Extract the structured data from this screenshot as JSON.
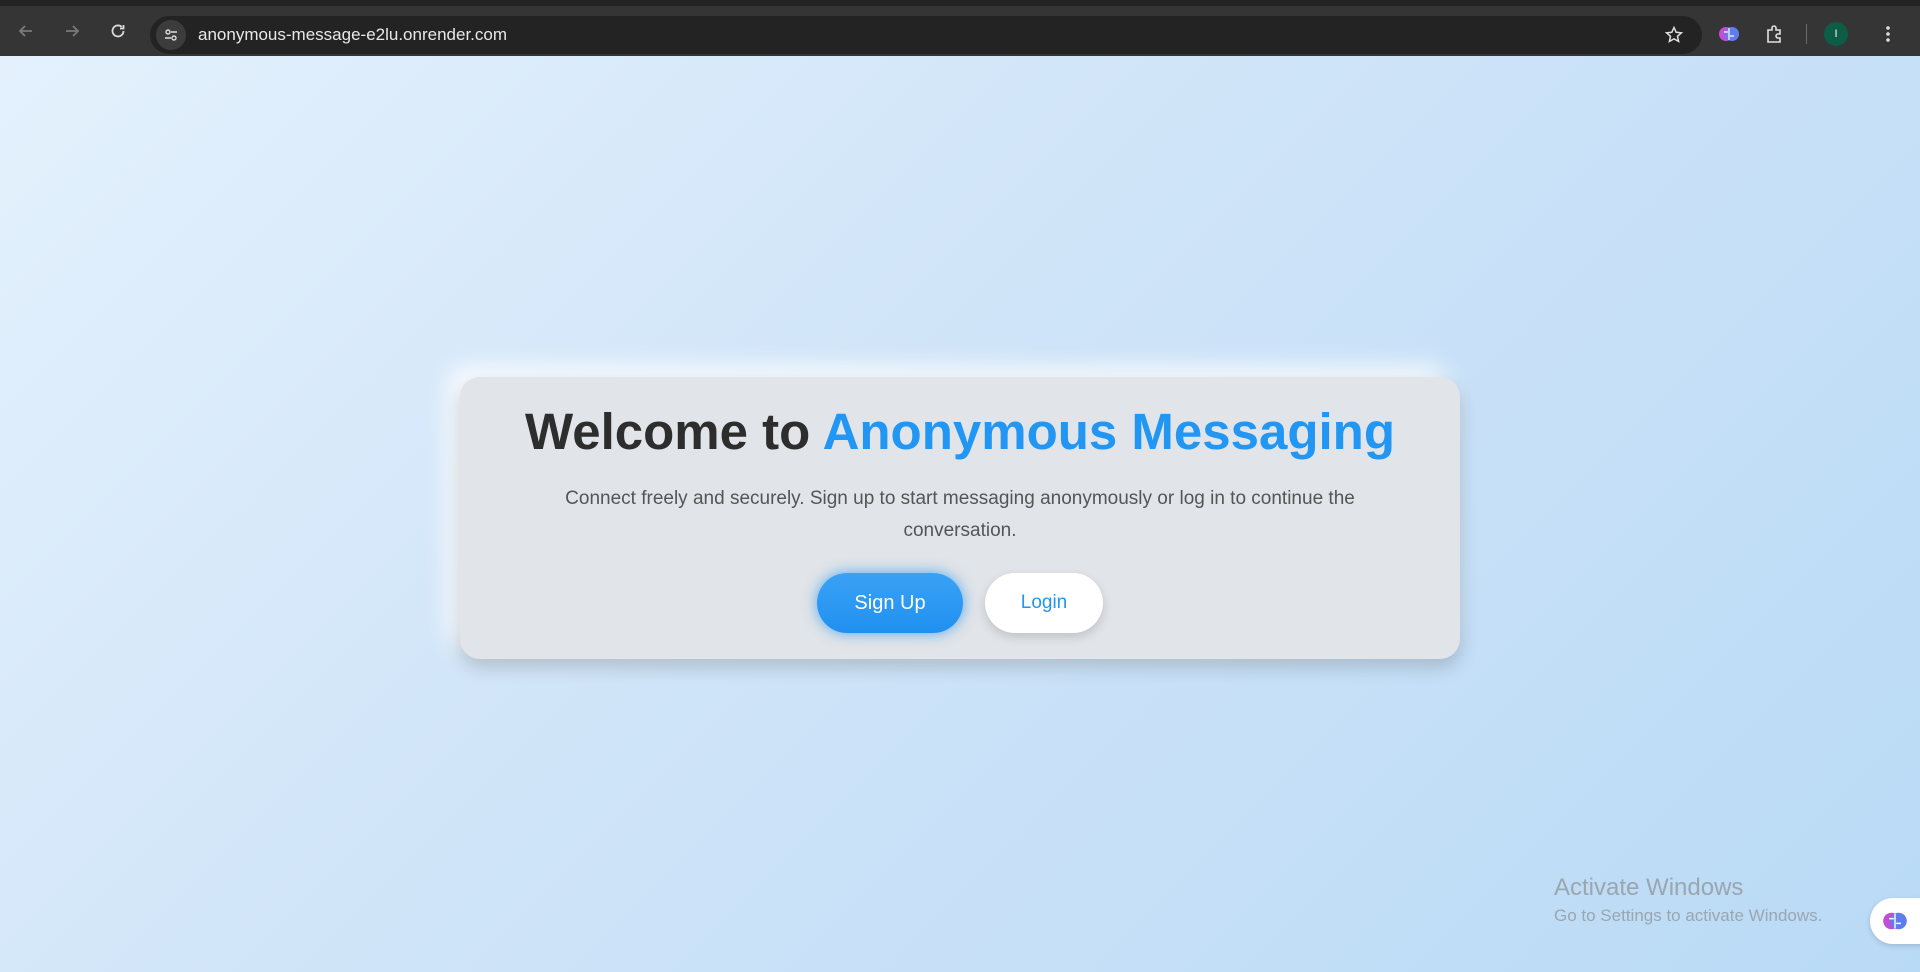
{
  "browser": {
    "url": "anonymous-message-e2lu.onrender.com",
    "profile_initial": "I"
  },
  "hero": {
    "title_prefix": "Welcome to ",
    "title_accent": "Anonymous Messaging",
    "subtitle": "Connect freely and securely. Sign up to start messaging anonymously or log in to continue the conversation.",
    "signup_label": "Sign Up",
    "login_label": "Login"
  },
  "watermark": {
    "title": "Activate Windows",
    "subtitle": "Go to Settings to activate Windows."
  },
  "colors": {
    "accent": "#2196f3",
    "card_bg": "#e1e4e8",
    "page_bg_start": "#e4f1fd",
    "page_bg_end": "#b9daf6"
  }
}
